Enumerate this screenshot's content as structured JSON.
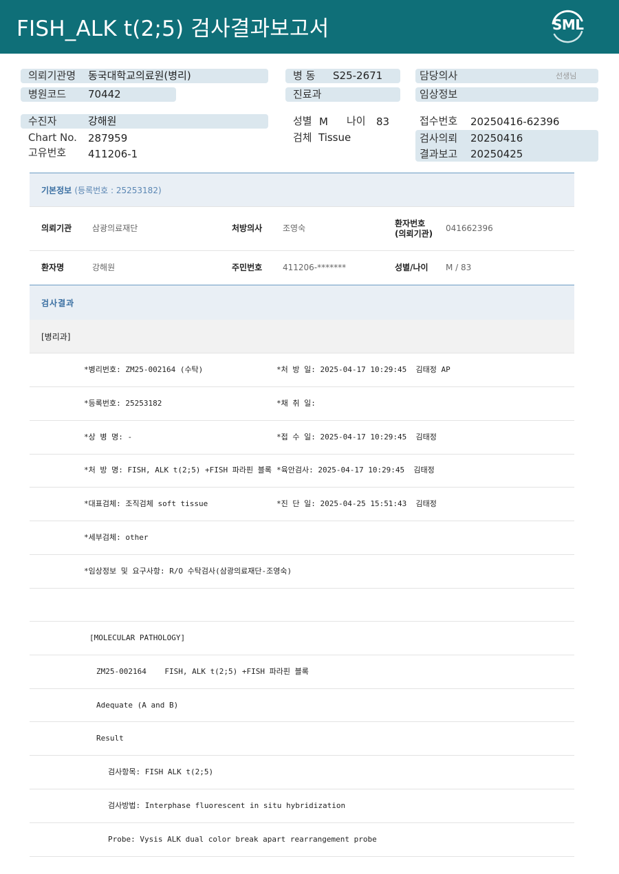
{
  "header": {
    "title": "FISH_ALK t(2;5) 검사결과보고서",
    "logo_text": "SML",
    "bg_color": "#0f6f78"
  },
  "info": {
    "req_org_label": "의뢰기관명",
    "req_org_value": "동국대학교의료원(병리)",
    "hosp_code_label": "병원코드",
    "hosp_code_value": "70442",
    "ward_label": "병 동",
    "ward_value": "S25-2671",
    "dept_label": "진료과",
    "dept_value": "",
    "doctor_label": "담당의사",
    "doctor_suffix": "선생님",
    "clinical_label": "임상정보",
    "clinical_value": "",
    "patient_label": "수진자",
    "patient_value": "강해원",
    "chart_label": "Chart No.",
    "chart_value": "287959",
    "uid_label": "고유번호",
    "uid_value": "411206-1",
    "sex_label": "성별",
    "sex_value": "M",
    "age_label": "나이",
    "age_value": "83",
    "specimen_label": "검체",
    "specimen_value": "Tissue",
    "receipt_label": "접수번호",
    "receipt_value": "20250416-62396",
    "req_date_label": "검사의뢰",
    "req_date_value": "20250416",
    "report_label": "결과보고",
    "report_value": "20250425"
  },
  "basic": {
    "title": "기본정보",
    "reg": "(등록번호 : 25253182)",
    "org_label": "의뢰기관",
    "org_value": "삼광의료재단",
    "presc_label": "처방의사",
    "presc_value": "조영숙",
    "pid_label_1": "환자번호",
    "pid_label_2": "(의뢰기관)",
    "pid_value": "041662396",
    "name_label": "환자명",
    "name_value": "강해원",
    "rrn_label": "주민번호",
    "rrn_value": "411206-*******",
    "sexage_label": "성별/나이",
    "sexage_value": "M / 83"
  },
  "result": {
    "title": "검사결과",
    "dept": "[병리과]",
    "rows": [
      {
        "left": "*병리번호: ZM25-002164 (수탁)",
        "right": "*처 방 일: 2025-04-17 10:29:45  김태정 AP"
      },
      {
        "left": "*등록번호: 25253182",
        "right": "*채 취 일:"
      },
      {
        "left": "*상 병 명: -",
        "right": "*접 수 일: 2025-04-17 10:29:45  김태정"
      },
      {
        "left": "*처 방 명: FISH, ALK t(2;5) +FISH 파라핀 블록",
        "right": "*육안검사: 2025-04-17 10:29:45  김태정"
      },
      {
        "left": "*대표검체: 조직검체 soft tissue",
        "right": "*진 단 일: 2025-04-25 15:51:43  김태정"
      },
      {
        "left": "*세부검체: other",
        "right": ""
      },
      {
        "left": "*임상정보 및 요구사항: R/O 수탁검사(삼광의료재단-조영숙)",
        "right": ""
      }
    ],
    "mol_title": "[MOLECULAR PATHOLOGY]",
    "mol_line": "ZM25-002164    FISH, ALK t(2;5) +FISH 파라핀 블록",
    "adequate": "Adequate (A and B)",
    "result_label": "Result",
    "item": "검사항목: FISH ALK t(2;5)",
    "method": "검사방법: Interphase fluorescent in situ hybridization",
    "probe": "Probe: Vysis ALK dual color break apart rearrangement probe"
  }
}
